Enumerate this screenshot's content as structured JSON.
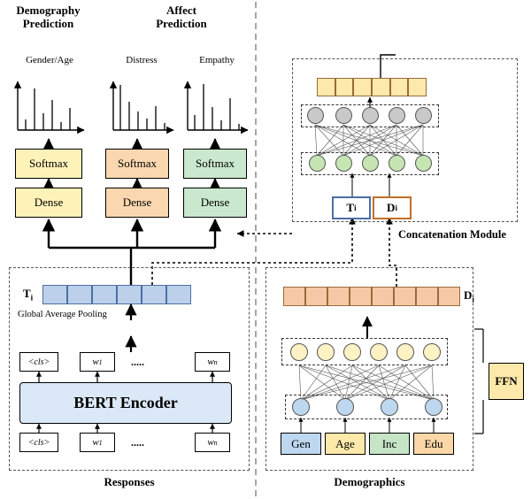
{
  "titles": {
    "demography_prediction": "Demography\nPrediction",
    "affect_prediction": "Affect\nPrediction",
    "gender_age": "Gender/Age",
    "distress": "Distress",
    "empathy": "Empathy"
  },
  "blocks": {
    "softmax": "Softmax",
    "dense": "Dense",
    "bert_encoder": "BERT Encoder",
    "global_average_pooling": "Global Average Pooling",
    "ffn": "FFN"
  },
  "tokens": {
    "cls_upper": "<cls>",
    "cls_lower": "<cls>",
    "w1_upper": "w",
    "w1_upper_sub": "1",
    "wn_upper": "w",
    "wn_upper_sub": "n",
    "w1_lower": "w",
    "w1_lower_sub": "1",
    "wn_lower": "w",
    "wn_lower_sub": "n",
    "ellipsis": "....."
  },
  "vectors": {
    "t_i": "T",
    "t_i_sub": "i",
    "d_i": "D",
    "d_i_sub": "i"
  },
  "sections": {
    "responses": "Responses",
    "demographics": "Demographics",
    "concatenation_module": "Concatenation Module"
  },
  "demographic_features": [
    {
      "label": "Gen",
      "color": "#bdd7ee"
    },
    {
      "label": "Age",
      "color": "#fde9a9"
    },
    {
      "label": "Inc",
      "color": "#c6e5c7"
    },
    {
      "label": "Edu",
      "color": "#fbd7a8"
    }
  ],
  "colors": {
    "softmax_gender": "#fdf2b8",
    "softmax_distress": "#fbd7b0",
    "softmax_empathy": "#c9e8cd",
    "dense_gender": "#fdf2b8",
    "dense_distress": "#fbd7b0",
    "dense_empathy": "#c9e8cd",
    "bert": "#dbe8f7",
    "t_vector_cell": "#bdd0ea",
    "d_vector_cell": "#f5c9a6",
    "concat_top_cell": "#fde9a9",
    "node_gray": "#c9c9c9",
    "node_green": "#c6e5b3",
    "node_blue": "#bdd7ee",
    "node_cream": "#fdf2c4",
    "ffn": "#fde9a9"
  },
  "charts": [
    {
      "name": "gender-age-distribution",
      "values": [
        0.22,
        0.9,
        0.35,
        0.62,
        0.18,
        0.45
      ]
    },
    {
      "name": "distress-distribution",
      "values": [
        0.95,
        0.6,
        0.38,
        0.25,
        0.5,
        0.15
      ]
    },
    {
      "name": "empathy-distribution",
      "values": [
        0.3,
        0.92,
        0.48,
        0.2,
        0.65,
        0.12
      ]
    }
  ]
}
